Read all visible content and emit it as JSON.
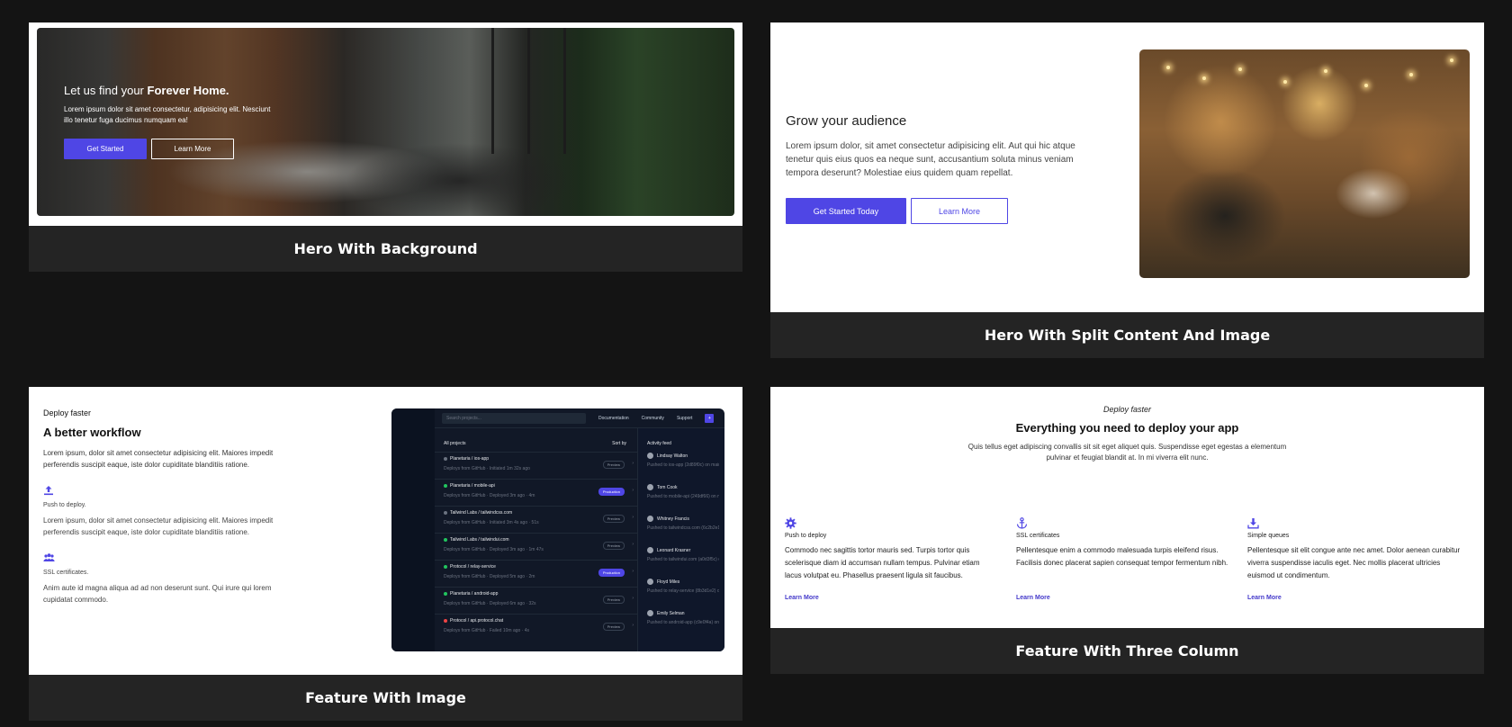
{
  "cards": [
    {
      "caption": "Hero With Background",
      "hero": {
        "title_prefix": "Let us find your ",
        "title_bold": "Forever Home.",
        "subtitle": "Lorem ipsum dolor sit amet consectetur, adipisicing elit. Nesciunt illo tenetur fuga ducimus numquam ea!",
        "primary_button": "Get Started",
        "secondary_button": "Learn More"
      }
    },
    {
      "caption": "Hero With Split Content And Image",
      "split": {
        "title": "Grow your audience",
        "body": "Lorem ipsum dolor, sit amet consectetur adipisicing elit. Aut qui hic atque tenetur quis eius quos ea neque sunt, accusantium soluta minus veniam tempora deserunt? Molestiae eius quidem quam repellat.",
        "primary_button": "Get Started Today",
        "secondary_button": "Learn More"
      }
    },
    {
      "caption": "Feature With Image",
      "feature": {
        "eyebrow": "Deploy faster",
        "title": "A better workflow",
        "body": "Lorem ipsum, dolor sit amet consectetur adipisicing elit. Maiores impedit perferendis suscipit eaque, iste dolor cupiditate blanditiis ratione.",
        "items": [
          {
            "icon": "upload-icon",
            "label": "Push to deploy.",
            "desc": "Lorem ipsum, dolor sit amet consectetur adipisicing elit. Maiores impedit perferendis suscipit eaque, iste dolor cupiditate blanditiis ratione."
          },
          {
            "icon": "users-icon",
            "label": "SSL certificates.",
            "desc": "Anim aute id magna aliqua ad ad non deserunt sunt. Qui irure qui lorem cupidatat commodo."
          }
        ],
        "dashboard": {
          "search_placeholder": "Search projects...",
          "nav": [
            "Documentation",
            "Community",
            "Support"
          ],
          "plus": "+",
          "list_title": "All projects",
          "sort_label": "Sort by",
          "rows": [
            {
              "name": "Planetaria / ios-app",
              "sub": "Deploys from GitHub · Initiated 1m 32s ago",
              "badge": "Preview",
              "active": false,
              "dot": "#6b7280"
            },
            {
              "name": "Planetaria / mobile-api",
              "sub": "Deploys from GitHub · Deployed 3m ago · 4m",
              "badge": "Production",
              "active": true,
              "dot": "#22c55e"
            },
            {
              "name": "Tailwind Labs / tailwindcss.com",
              "sub": "Deploys from GitHub · Initiated 3m 4s ago · 51s",
              "badge": "Preview",
              "active": false,
              "dot": "#6b7280"
            },
            {
              "name": "Tailwind Labs / tailwindui.com",
              "sub": "Deploys from GitHub · Deployed 3m ago · 1m 47s",
              "badge": "Preview",
              "active": false,
              "dot": "#22c55e"
            },
            {
              "name": "Protocol / relay-service",
              "sub": "Deploys from GitHub · Deployed 5m ago · 2m",
              "badge": "Production",
              "active": true,
              "dot": "#22c55e"
            },
            {
              "name": "Planetaria / android-app",
              "sub": "Deploys from GitHub · Deployed 6m ago · 32s",
              "badge": "Preview",
              "active": false,
              "dot": "#22c55e"
            },
            {
              "name": "Protocol / api.protocol.chat",
              "sub": "Deploys from GitHub · Failed 10m ago · 4s",
              "badge": "Preview",
              "active": false,
              "dot": "#ef4444"
            }
          ],
          "feed_title": "Activity feed",
          "feed": [
            {
              "user": "Lindsay Walton",
              "sub": "Pushed to ios-app (2d89f0c) on main"
            },
            {
              "user": "Tom Cook",
              "sub": "Pushed to mobile-api (249df66) on main"
            },
            {
              "user": "Whitney Francis",
              "sub": "Pushed to tailwindcss.com (6c2b2e1) on main"
            },
            {
              "user": "Leonard Krasner",
              "sub": "Pushed to tailwindui.com (a0d3f5c) on main"
            },
            {
              "user": "Floyd Miles",
              "sub": "Pushed to relay-service (8b3d1e2) on main"
            },
            {
              "user": "Emily Selman",
              "sub": "Pushed to android-app (c9e0f4a) on main"
            }
          ]
        }
      }
    },
    {
      "caption": "Feature With Three Column",
      "three": {
        "eyebrow": "Deploy faster",
        "title": "Everything you need to deploy your app",
        "subtitle": "Quis tellus eget adipiscing convallis sit sit eget aliquet quis. Suspendisse eget egestas a elementum pulvinar et feugiat blandit at. In mi viverra elit nunc.",
        "columns": [
          {
            "icon": "gear-icon",
            "label": "Push to deploy",
            "desc": "Commodo nec sagittis tortor mauris sed. Turpis tortor quis scelerisque diam id accumsan nullam tempus. Pulvinar etiam lacus volutpat eu. Phasellus praesent ligula sit faucibus.",
            "link": "Learn More"
          },
          {
            "icon": "anchor-icon",
            "label": "SSL certificates",
            "desc": "Pellentesque enim a commodo malesuada turpis eleifend risus. Facilisis donec placerat sapien consequat tempor fermentum nibh.",
            "link": "Learn More"
          },
          {
            "icon": "download-icon",
            "label": "Simple queues",
            "desc": "Pellentesque sit elit congue ante nec amet. Dolor aenean curabitur viverra suspendisse iaculis eget. Nec mollis placerat ultricies euismod ut condimentum.",
            "link": "Learn More"
          }
        ]
      }
    }
  ],
  "colors": {
    "accent": "#4f46e5",
    "page_bg": "#141414",
    "caption_bg": "#242424"
  }
}
